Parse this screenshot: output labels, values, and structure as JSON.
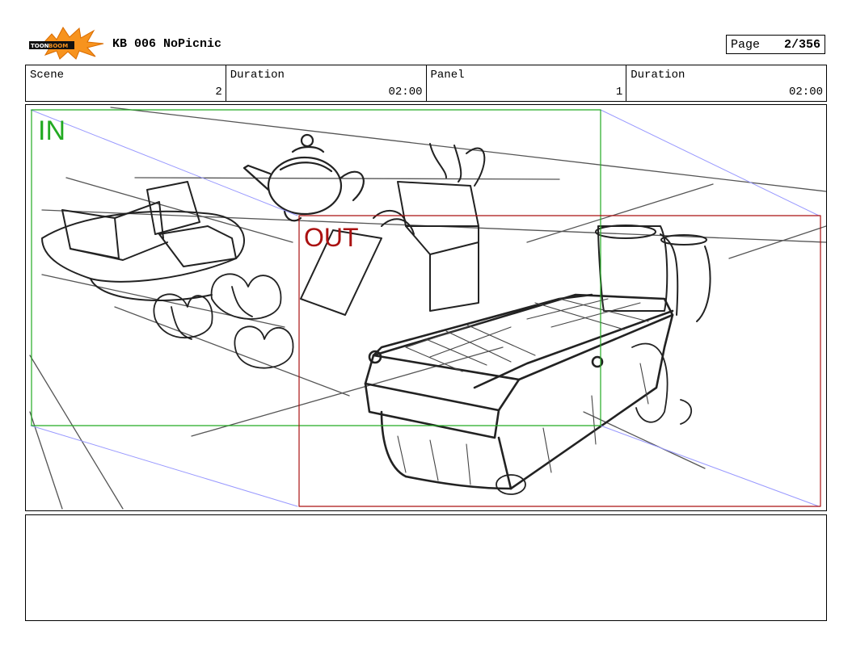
{
  "header": {
    "logo_icon": "toonboom-logo-icon",
    "logo_text": "TOON BOOM",
    "title": "KB 006 NoPicnic",
    "page_label": "Page",
    "page_value": "2/356"
  },
  "info": {
    "scene_label": "Scene",
    "scene_value": "2",
    "scene_duration_label": "Duration",
    "scene_duration_value": "02:00",
    "panel_label": "Panel",
    "panel_value": "1",
    "panel_duration_label": "Duration",
    "panel_duration_value": "02:00"
  },
  "panel": {
    "in_label": "IN",
    "out_label": "OUT",
    "in_color": "#22aa22",
    "out_color": "#aa1111",
    "camera_path_color": "#9999ff"
  },
  "notes": {
    "text": ""
  }
}
